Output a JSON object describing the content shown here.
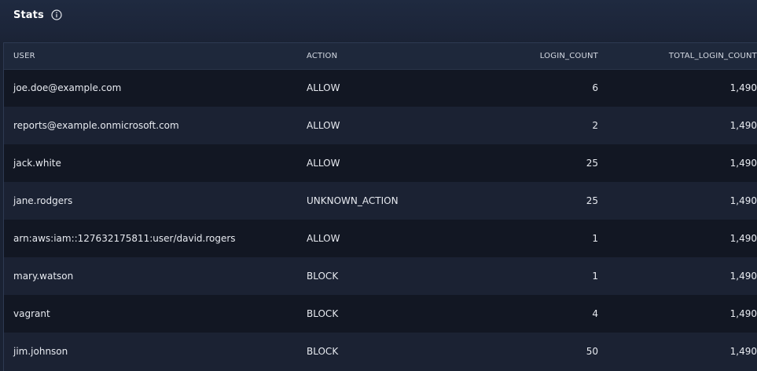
{
  "header": {
    "title": "Stats",
    "info_icon": "info-circle-icon"
  },
  "table": {
    "columns": [
      "USER",
      "ACTION",
      "LOGIN_COUNT",
      "TOTAL_LOGIN_COUNT"
    ],
    "rows": [
      {
        "user": "joe.doe@example.com",
        "action": "ALLOW",
        "login_count": "6",
        "total_login_count": "1,490"
      },
      {
        "user": "reports@example.onmicrosoft.com",
        "action": "ALLOW",
        "login_count": "2",
        "total_login_count": "1,490"
      },
      {
        "user": "jack.white",
        "action": "ALLOW",
        "login_count": "25",
        "total_login_count": "1,490"
      },
      {
        "user": "jane.rodgers",
        "action": "UNKNOWN_ACTION",
        "login_count": "25",
        "total_login_count": "1,490"
      },
      {
        "user": "arn:aws:iam::127632175811:user/david.rogers",
        "action": "ALLOW",
        "login_count": "1",
        "total_login_count": "1,490"
      },
      {
        "user": "mary.watson",
        "action": "BLOCK",
        "login_count": "1",
        "total_login_count": "1,490"
      },
      {
        "user": "vagrant",
        "action": "BLOCK",
        "login_count": "4",
        "total_login_count": "1,490"
      },
      {
        "user": "jim.johnson",
        "action": "BLOCK",
        "login_count": "50",
        "total_login_count": "1,490"
      }
    ]
  },
  "colors": {
    "background": "#1a2233",
    "row_dark": "#121723",
    "row_light": "#1b2233",
    "text": "#e7eaf0"
  }
}
